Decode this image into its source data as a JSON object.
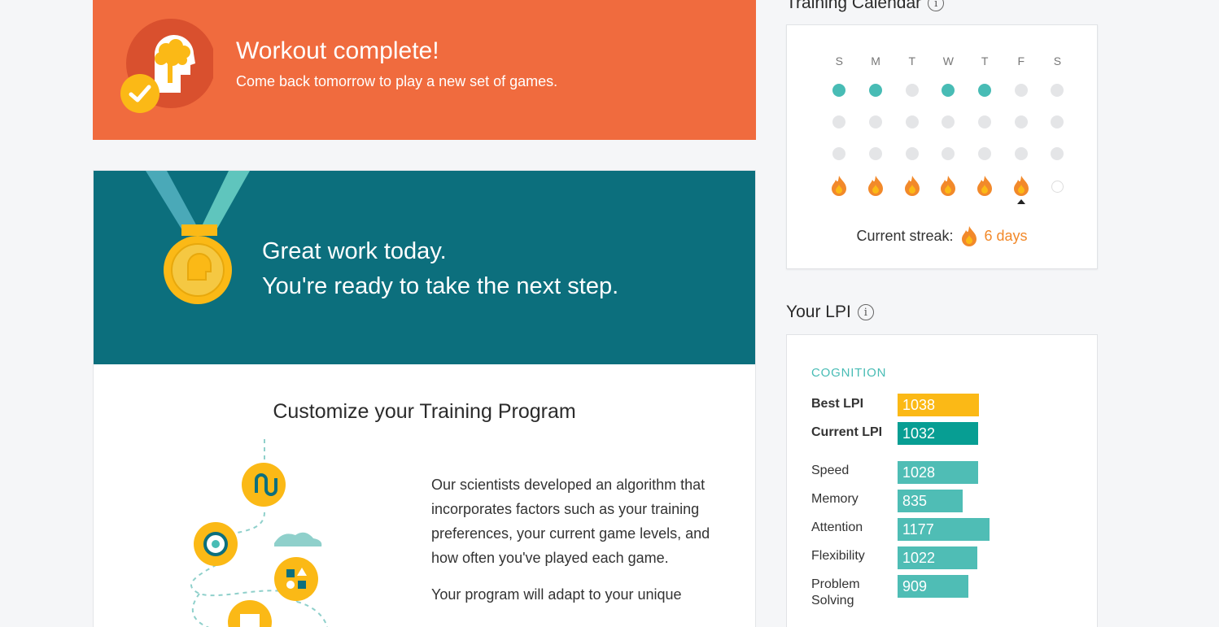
{
  "workout": {
    "title": "Workout complete!",
    "subtitle": "Come back tomorrow to play a new set of games."
  },
  "great_work": {
    "line1": "Great work today.",
    "line2": "You're ready to take the next step."
  },
  "customize": {
    "title": "Customize your Training Program",
    "para1": "Our scientists developed an algorithm that incorporates factors such as your training preferences, your current game levels, and how often you've played each game.",
    "para2": "Your program will adapt to your unique"
  },
  "calendar": {
    "title": "Training Calendar",
    "days": [
      "S",
      "M",
      "T",
      "W",
      "T",
      "F",
      "S"
    ],
    "streak_label": "Current streak:",
    "streak_value": "6 days",
    "colors": {
      "active": "#48bcb5",
      "inactive": "#e4e5e7",
      "flame": "#f2892a"
    }
  },
  "lpi": {
    "title": "Your LPI",
    "category": "COGNITION",
    "best": {
      "label": "Best LPI",
      "value": "1038"
    },
    "current": {
      "label": "Current LPI",
      "value": "1032"
    },
    "areas": [
      {
        "label": "Speed",
        "value": "1028"
      },
      {
        "label": "Memory",
        "value": "835"
      },
      {
        "label": "Attention",
        "value": "1177"
      },
      {
        "label": "Flexibility",
        "value": "1022"
      },
      {
        "label": "Problem Solving",
        "value": "909"
      }
    ],
    "colors": {
      "best": "#fbb916",
      "current": "#079e93",
      "area": "#4fbdb5"
    }
  }
}
